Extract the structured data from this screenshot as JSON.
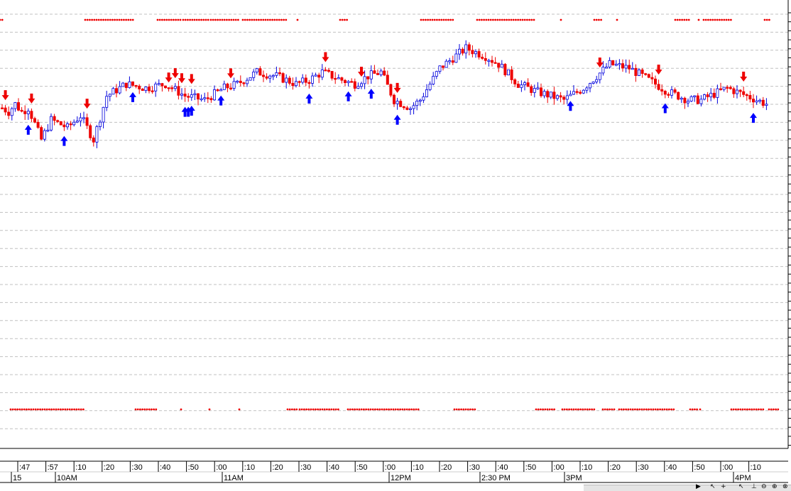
{
  "chart_data": {
    "type": "candlestick",
    "colors": {
      "up_candle": "#0000dd",
      "down_candle": "#ee0000",
      "buy_signal": "#0000ff",
      "sell_signal": "#ee0000",
      "dot_markers": "#ee0000",
      "grid": "#c0c0c0"
    },
    "grid": true,
    "y_range": [
      0,
      100
    ],
    "x_tick_labels": [
      ":47",
      ":57",
      ":10",
      ":20",
      ":30",
      ":40",
      ":50",
      ":00",
      ":10",
      ":20",
      ":30",
      ":40",
      ":50",
      ":00",
      ":10",
      ":20",
      ":30",
      ":40",
      ":50",
      ":00",
      ":10",
      ":20",
      ":30",
      ":40",
      ":50",
      ":00",
      ":10"
    ],
    "x_major_labels": [
      "15",
      "10AM",
      "11AM",
      "12PM",
      "2:30 PM",
      "3PM",
      "4PM"
    ],
    "price_path_keypoints": [
      [
        0,
        80
      ],
      [
        2,
        79
      ],
      [
        4,
        81
      ],
      [
        6,
        79
      ],
      [
        8,
        80
      ],
      [
        12,
        72
      ],
      [
        15,
        77
      ],
      [
        20,
        75
      ],
      [
        24,
        78
      ],
      [
        28,
        72
      ],
      [
        32,
        83
      ],
      [
        38,
        86
      ],
      [
        44,
        85
      ],
      [
        50,
        86
      ],
      [
        56,
        83
      ],
      [
        62,
        82
      ],
      [
        68,
        85
      ],
      [
        72,
        86
      ],
      [
        78,
        89
      ],
      [
        84,
        88
      ],
      [
        90,
        86
      ],
      [
        94,
        87
      ],
      [
        98,
        89
      ],
      [
        104,
        87
      ],
      [
        108,
        86
      ],
      [
        112,
        88
      ],
      [
        116,
        89
      ],
      [
        120,
        82
      ],
      [
        125,
        80
      ],
      [
        128,
        82
      ],
      [
        134,
        90
      ],
      [
        142,
        95
      ],
      [
        148,
        93
      ],
      [
        152,
        91
      ],
      [
        158,
        86
      ],
      [
        164,
        84
      ],
      [
        172,
        82
      ],
      [
        178,
        85
      ],
      [
        186,
        91
      ],
      [
        192,
        90
      ],
      [
        198,
        87
      ],
      [
        204,
        84
      ],
      [
        210,
        82
      ],
      [
        214,
        82
      ],
      [
        222,
        85
      ],
      [
        228,
        83
      ],
      [
        234,
        81
      ]
    ],
    "top_dot_ranges": [
      [
        0,
        6
      ],
      [
        120,
        190
      ],
      [
        222,
        256
      ],
      [
        258,
        294
      ],
      [
        297,
        336
      ],
      [
        342,
        404
      ],
      [
        419,
        422
      ],
      [
        479,
        489
      ],
      [
        593,
        640
      ],
      [
        672,
        753
      ],
      [
        790,
        793
      ],
      [
        837,
        848
      ],
      [
        869,
        872
      ],
      [
        951,
        971
      ],
      [
        984,
        987
      ],
      [
        991,
        1030
      ],
      [
        1077,
        1084
      ]
    ],
    "bottom_dot_ranges": [
      [
        15,
        118
      ],
      [
        191,
        222
      ],
      [
        255,
        258
      ],
      [
        295,
        298
      ],
      [
        337,
        340
      ],
      [
        405,
        418
      ],
      [
        422,
        478
      ],
      [
        490,
        592
      ],
      [
        640,
        672
      ],
      [
        755,
        781
      ],
      [
        792,
        838
      ],
      [
        849,
        868
      ],
      [
        872,
        950
      ],
      [
        972,
        983
      ],
      [
        986,
        989
      ],
      [
        1030,
        1076
      ],
      [
        1083,
        1097
      ]
    ],
    "buy_signal_bars": [
      8,
      19,
      40,
      56,
      57,
      58,
      67,
      94,
      106,
      113,
      121,
      174,
      203,
      230
    ],
    "sell_signal_bars": [
      1,
      9,
      26,
      51,
      53,
      55,
      58,
      70,
      99,
      110,
      121,
      183,
      201,
      227
    ]
  }
}
